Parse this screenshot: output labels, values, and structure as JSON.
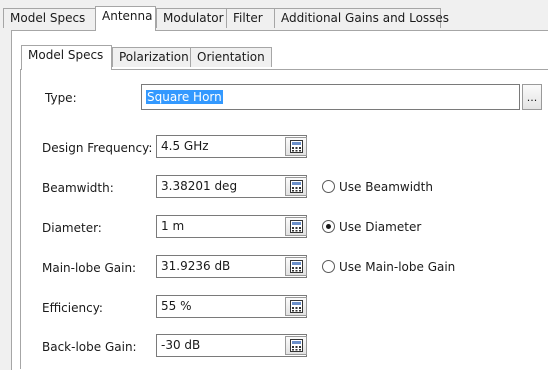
{
  "top_tabs": [
    "Model Specs",
    "Antenna",
    "Modulator",
    "Filter",
    "Additional Gains and Losses"
  ],
  "active_top_tab": "Antenna",
  "sub_tabs": [
    "Model Specs",
    "Polarization",
    "Orientation"
  ],
  "active_sub_tab": "Model Specs",
  "type": {
    "label": "Type:",
    "value": "Square Horn",
    "browse_label": "..."
  },
  "fields": [
    {
      "label": "Design Frequency:",
      "value": "4.5 GHz"
    },
    {
      "label": "Beamwidth:",
      "value": "3.38201 deg",
      "radio_label": "Use Beamwidth",
      "radio_selected": false
    },
    {
      "label": "Diameter:",
      "value": "1 m",
      "radio_label": "Use Diameter",
      "radio_selected": true
    },
    {
      "label": "Main-lobe Gain:",
      "value": "31.9236 dB",
      "radio_label": "Use Main-lobe Gain",
      "radio_selected": false
    },
    {
      "label": "Efficiency:",
      "value": "55 %"
    },
    {
      "label": "Back-lobe Gain:",
      "value": "-30 dB"
    }
  ],
  "colors": {
    "selection": "#3399ff",
    "border": "#a6a6a6"
  },
  "icons": {
    "calculator": "calculator-icon",
    "radio": "radio-button"
  }
}
